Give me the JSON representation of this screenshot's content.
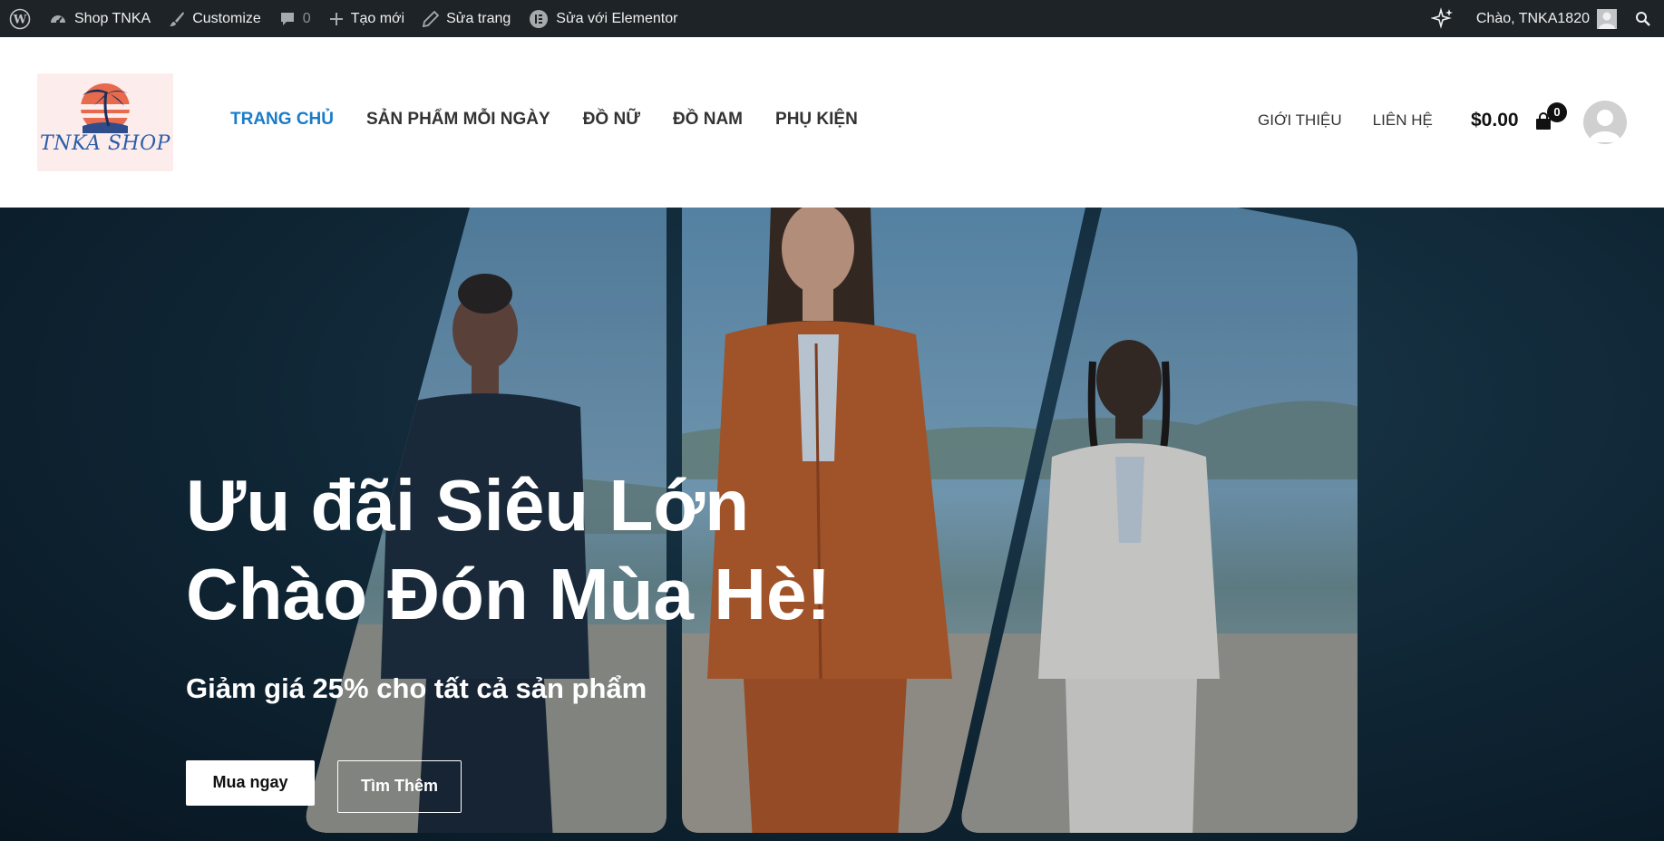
{
  "adminbar": {
    "site_name": "Shop TNKA",
    "customize": "Customize",
    "comments_count": "0",
    "new_label": "Tạo mới",
    "edit_page": "Sửa trang",
    "elementor": "Sửa với Elementor",
    "greeting": "Chào, TNKA1820"
  },
  "header": {
    "logo_text": "TNKA SHOP",
    "main_nav": [
      "TRANG CHỦ",
      "SẢN PHẨM MỖI NGÀY",
      "ĐỒ NỮ",
      "ĐỒ NAM",
      "PHỤ KIỆN"
    ],
    "secondary_nav": [
      "GIỚI THIỆU",
      "LIÊN HỆ"
    ],
    "cart_total": "$0.00",
    "cart_count": "0"
  },
  "hero": {
    "title_line1": "Ưu đãi Siêu Lớn",
    "title_line2": "Chào Đón Mùa Hè!",
    "subtitle": "Giảm giá 25% cho tất cả sản phẩm",
    "primary_button": "Mua ngay",
    "secondary_button": "Tìm Thêm"
  },
  "colors": {
    "adminbar_bg": "#1d2327",
    "nav_active": "#1a7cc9",
    "hero_bg": "#0f2534"
  }
}
